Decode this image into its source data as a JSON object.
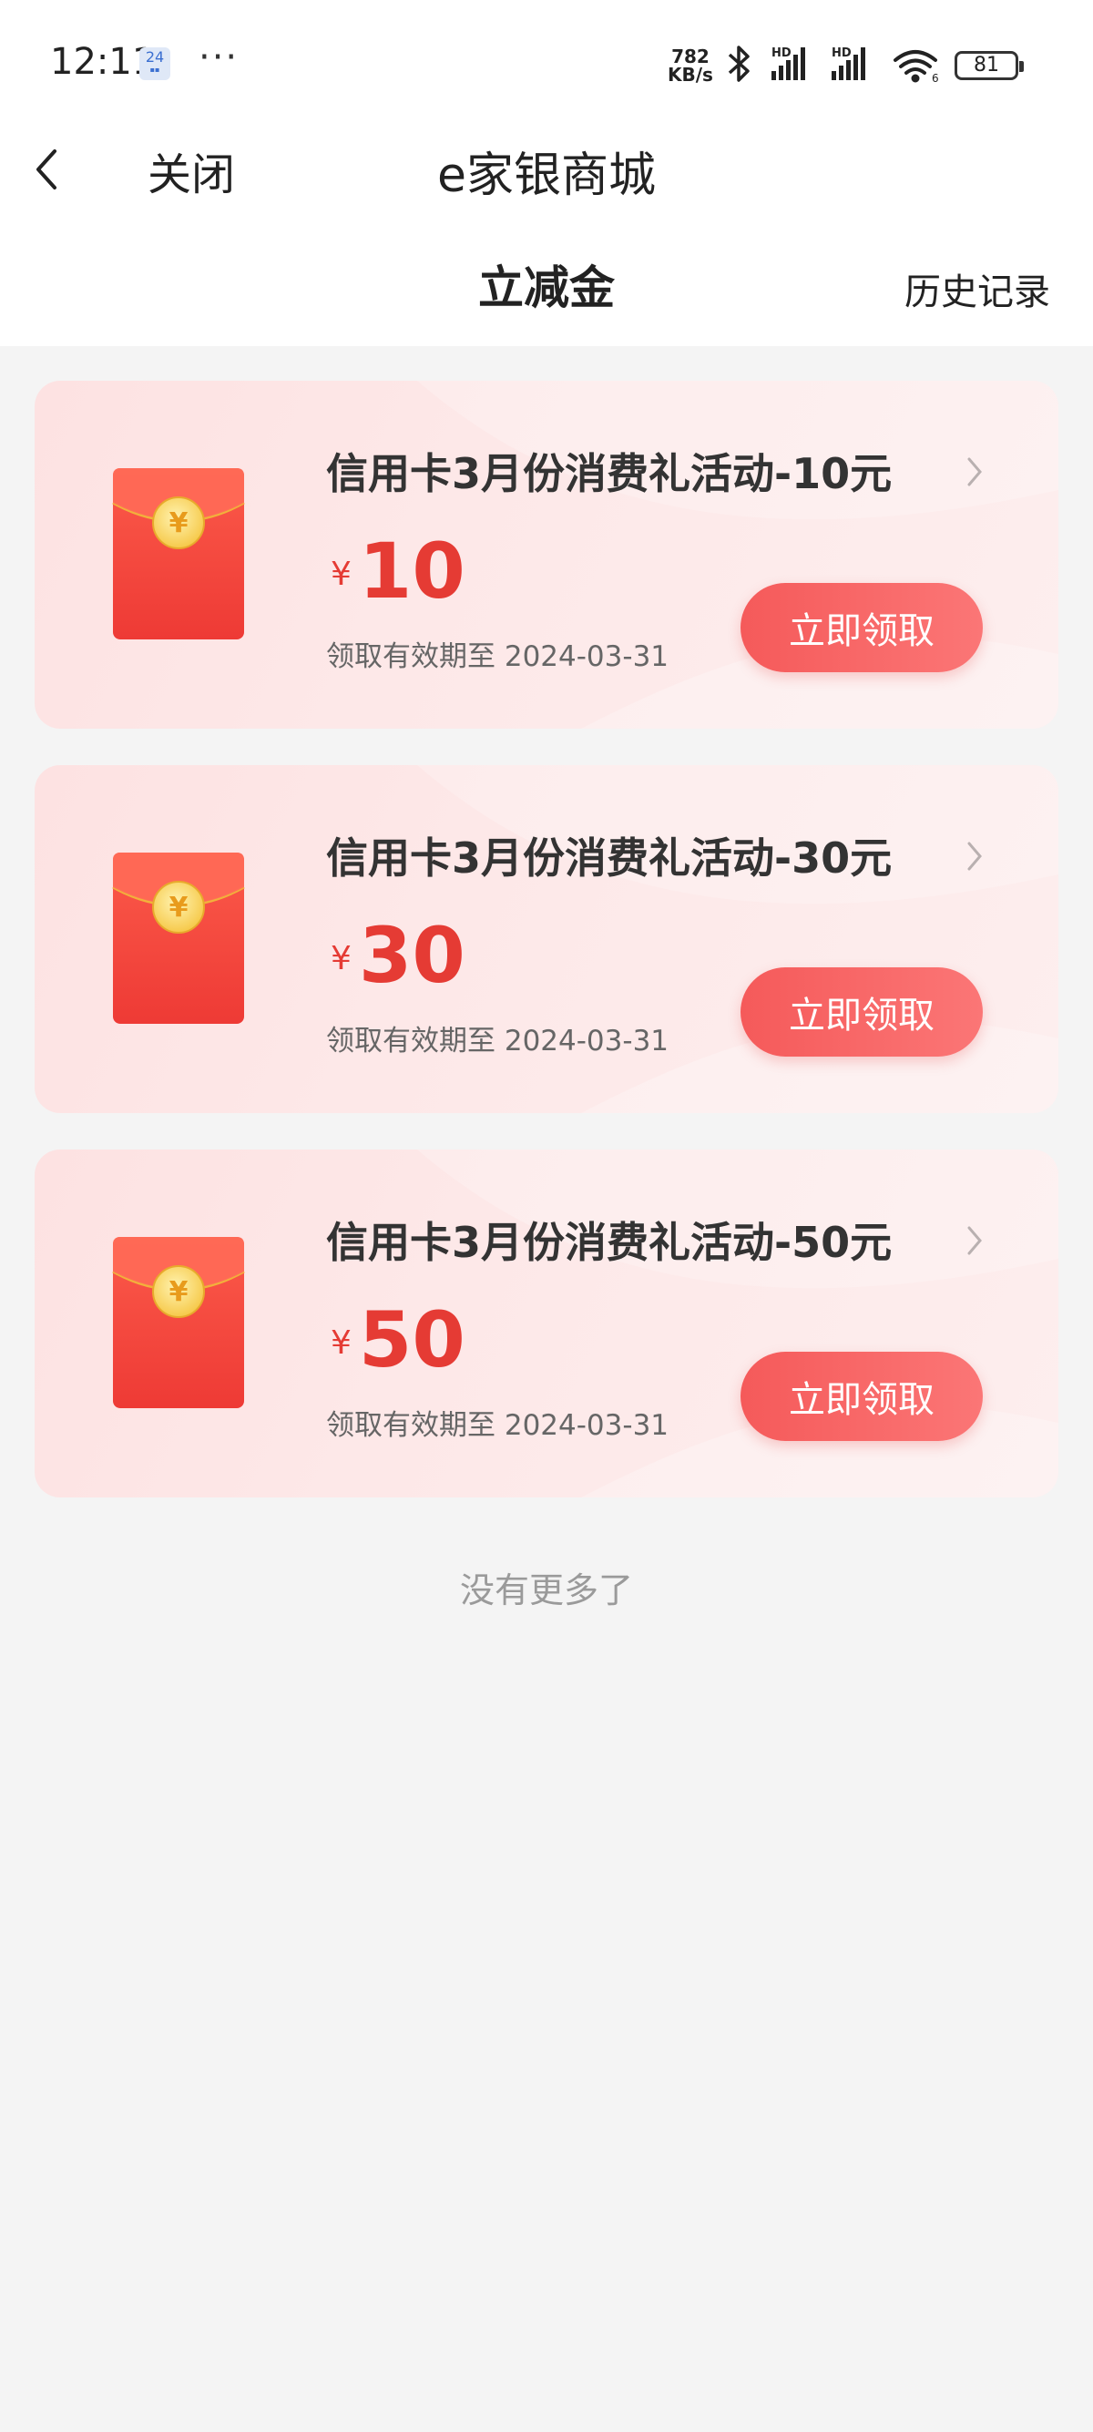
{
  "status_bar": {
    "time": "12:11",
    "calendar_day": "24",
    "network_speed_value": "782",
    "network_speed_unit": "KB/s",
    "battery": "81"
  },
  "nav": {
    "close_label": "关闭",
    "title": "e家银商城"
  },
  "sub_header": {
    "title": "立减金",
    "history_label": "历史记录"
  },
  "coupons": [
    {
      "title": "信用卡3月份消费礼活动-10元",
      "currency": "¥",
      "amount": "10",
      "expiry": "领取有效期至 2024-03-31",
      "button": "立即领取"
    },
    {
      "title": "信用卡3月份消费礼活动-30元",
      "currency": "¥",
      "amount": "30",
      "expiry": "领取有效期至 2024-03-31",
      "button": "立即领取"
    },
    {
      "title": "信用卡3月份消费礼活动-50元",
      "currency": "¥",
      "amount": "50",
      "expiry": "领取有效期至 2024-03-31",
      "button": "立即领取"
    }
  ],
  "footer_text": "没有更多了",
  "colors": {
    "accent_red": "#e53b34",
    "button_red": "#f55a5a",
    "card_bg": "#fde4e4",
    "page_bg": "#f4f4f4"
  }
}
